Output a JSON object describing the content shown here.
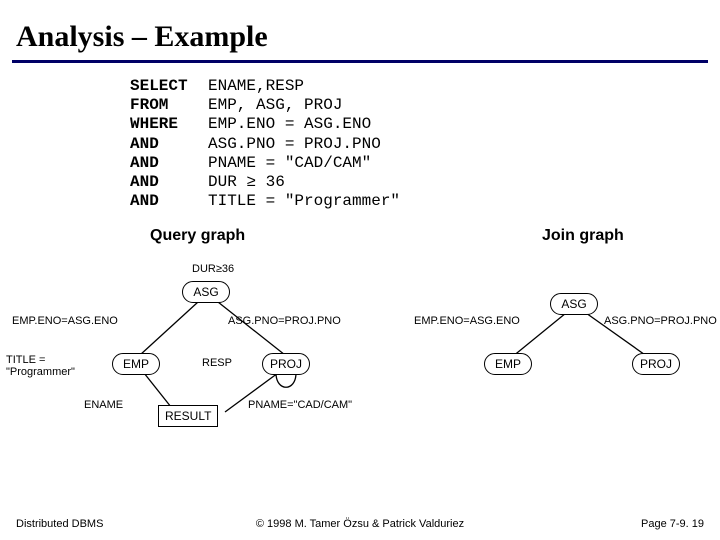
{
  "title": "Analysis – Example",
  "sql": {
    "lines": [
      {
        "kw": "SELECT",
        "rest": "ENAME,RESP"
      },
      {
        "kw": "FROM",
        "rest": "EMP, ASG, PROJ"
      },
      {
        "kw": "WHERE",
        "rest": "EMP.ENO = ASG.ENO"
      },
      {
        "kw": "AND",
        "rest": "ASG.PNO = PROJ.PNO"
      },
      {
        "kw": "AND",
        "rest": "PNAME = \"CAD/CAM\""
      },
      {
        "kw": "AND",
        "rest": "DUR ≥ 36"
      },
      {
        "kw": "AND",
        "rest": "TITLE = \"Programmer\""
      }
    ]
  },
  "labels": {
    "query_graph": "Query graph",
    "join_graph": "Join graph"
  },
  "qg": {
    "dur": "DUR≥36",
    "asg": "ASG",
    "emp": "EMP",
    "proj": "PROJ",
    "result": "RESULT",
    "edge_emp_asg": "EMP.ENO=ASG.ENO",
    "edge_asg_proj": "ASG.PNO=PROJ.PNO",
    "title_pred": "TITLE =\n\"Programmer\"",
    "ename": "ENAME",
    "resp": "RESP",
    "pname_pred": "PNAME=\"CAD/CAM\""
  },
  "jgraph": {
    "asg": "ASG",
    "emp": "EMP",
    "proj": "PROJ",
    "edge_emp_asg": "EMP.ENO=ASG.ENO",
    "edge_asg_proj": "ASG.PNO=PROJ.PNO"
  },
  "footer": {
    "left": "Distributed DBMS",
    "center": "© 1998 M. Tamer Özsu & Patrick Valduriez",
    "right": "Page 7-9. 19"
  }
}
